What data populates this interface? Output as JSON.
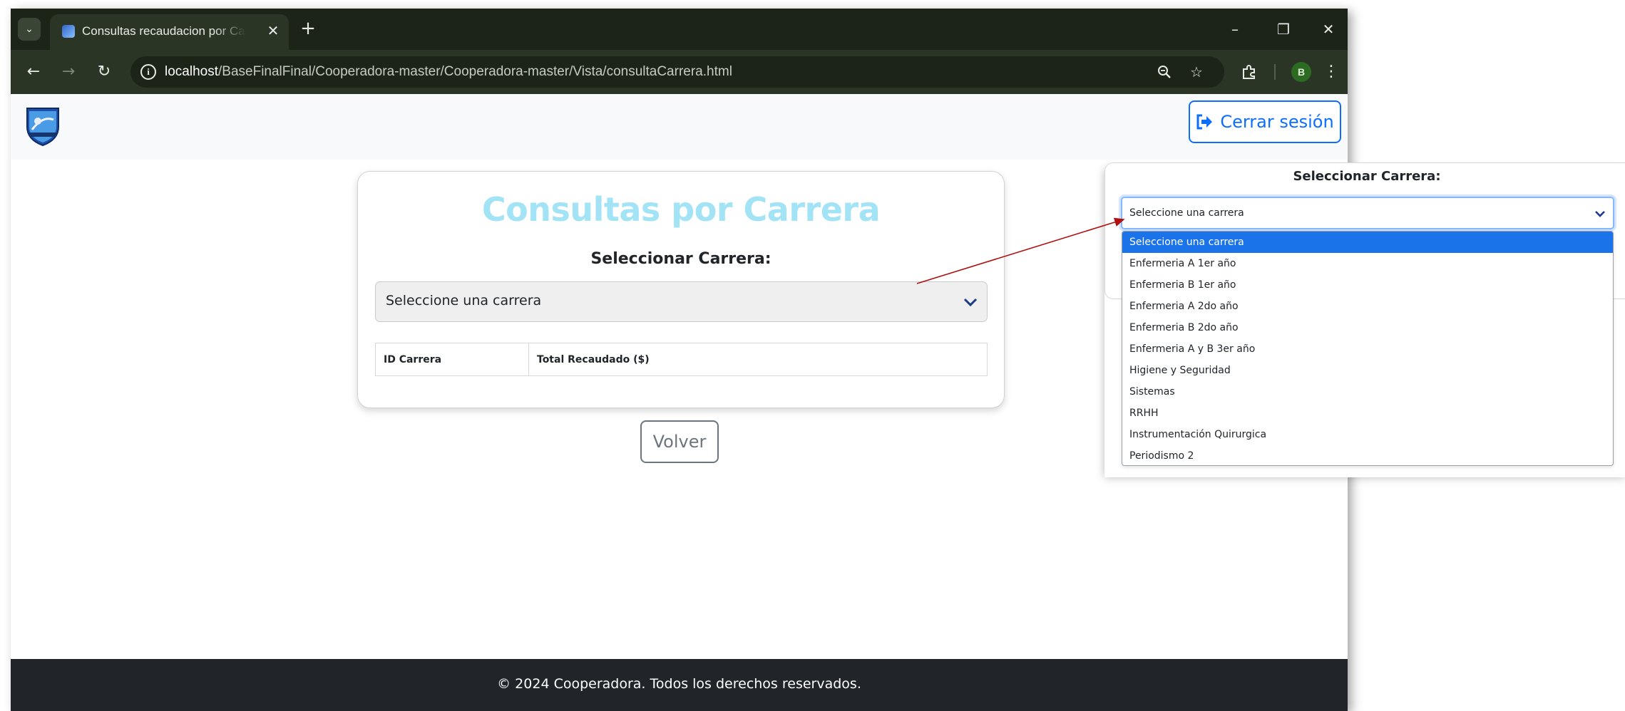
{
  "browser": {
    "tab_title": "Consultas recaudacion por Carrera",
    "url_host": "localhost",
    "url_path": "/BaseFinalFinal/Cooperadora-master/Cooperadora-master/Vista/consultaCarrera.html",
    "profile_initial": "B"
  },
  "header": {
    "logout_label": "Cerrar sesión"
  },
  "card": {
    "title": "Consultas por Carrera",
    "select_label": "Seleccionar Carrera:",
    "select_value": "Seleccione una carrera",
    "table_headers": [
      "ID Carrera",
      "Total Recaudado ($)"
    ]
  },
  "back_label": "Volver",
  "footer_text": "© 2024 Cooperadora. Todos los derechos reservados.",
  "callout": {
    "label": "Seleccionar Carrera:",
    "select_value": "Seleccione una carrera",
    "options": [
      "Seleccione una carrera",
      "Enfermeria A 1er año",
      "Enfermeria B 1er año",
      "Enfermeria A 2do año",
      "Enfermeria B 2do año",
      "Enfermeria A y B 3er año",
      "Higiene y Seguridad",
      "Sistemas",
      "RRHH",
      "Instrumentación Quirurgica",
      "Periodismo 2"
    ],
    "selected_index": 0
  },
  "colors": {
    "accent": "#0d6efd",
    "title": "#a2e3f5",
    "footer": "#212529",
    "arrow": "#b01010"
  }
}
